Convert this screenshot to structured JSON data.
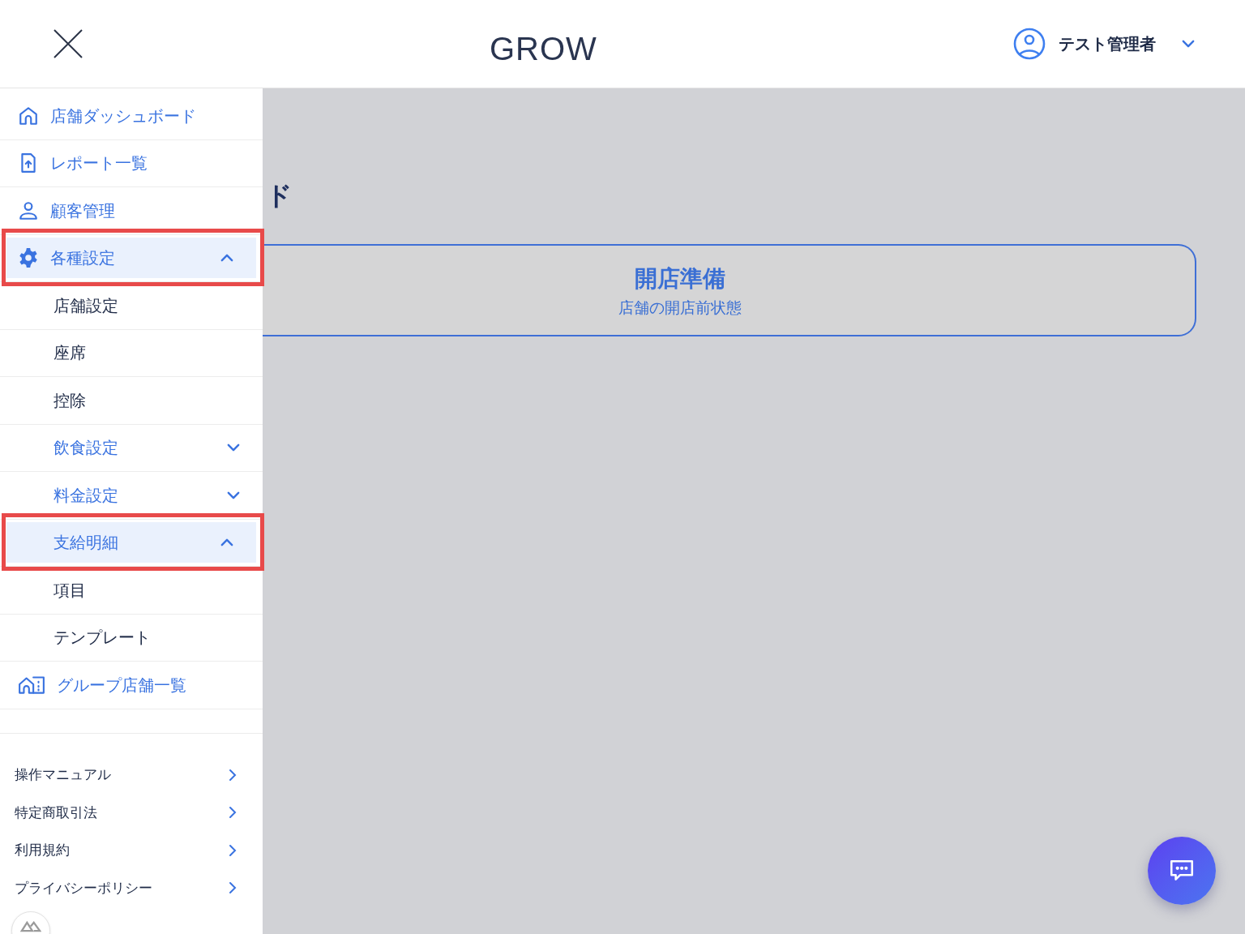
{
  "header": {
    "logo": "GROW",
    "user": {
      "name": "テスト管理者"
    }
  },
  "sidebar": {
    "items": [
      {
        "label": "店舗ダッシュボード",
        "expanded": false,
        "outlined": false
      },
      {
        "label": "レポート一覧",
        "expanded": false,
        "outlined": false
      },
      {
        "label": "顧客管理",
        "expanded": false,
        "outlined": false
      },
      {
        "label": "各種設定",
        "expanded": true,
        "outlined": true,
        "children": [
          {
            "label": "店舗設定",
            "kind": "link",
            "expanded": false,
            "outlined": false
          },
          {
            "label": "座席",
            "kind": "link",
            "expanded": false,
            "outlined": false
          },
          {
            "label": "控除",
            "kind": "link",
            "expanded": false,
            "outlined": false
          },
          {
            "label": "飲食設定",
            "kind": "group",
            "expanded": false,
            "outlined": false
          },
          {
            "label": "料金設定",
            "kind": "group",
            "expanded": false,
            "outlined": false
          },
          {
            "label": "支給明細",
            "kind": "group",
            "expanded": true,
            "outlined": true,
            "children": [
              {
                "label": "項目"
              },
              {
                "label": "テンプレート"
              }
            ]
          }
        ]
      },
      {
        "label": "グループ店舗一覧",
        "expanded": false,
        "outlined": false
      }
    ],
    "footer_links": [
      "操作マニュアル",
      "特定商取引法",
      "利用規約",
      "プライバシーポリシー"
    ]
  },
  "main": {
    "title": "ド",
    "status_card": {
      "title": "開店準備",
      "subtitle": "店舗の開店前状態"
    }
  }
}
